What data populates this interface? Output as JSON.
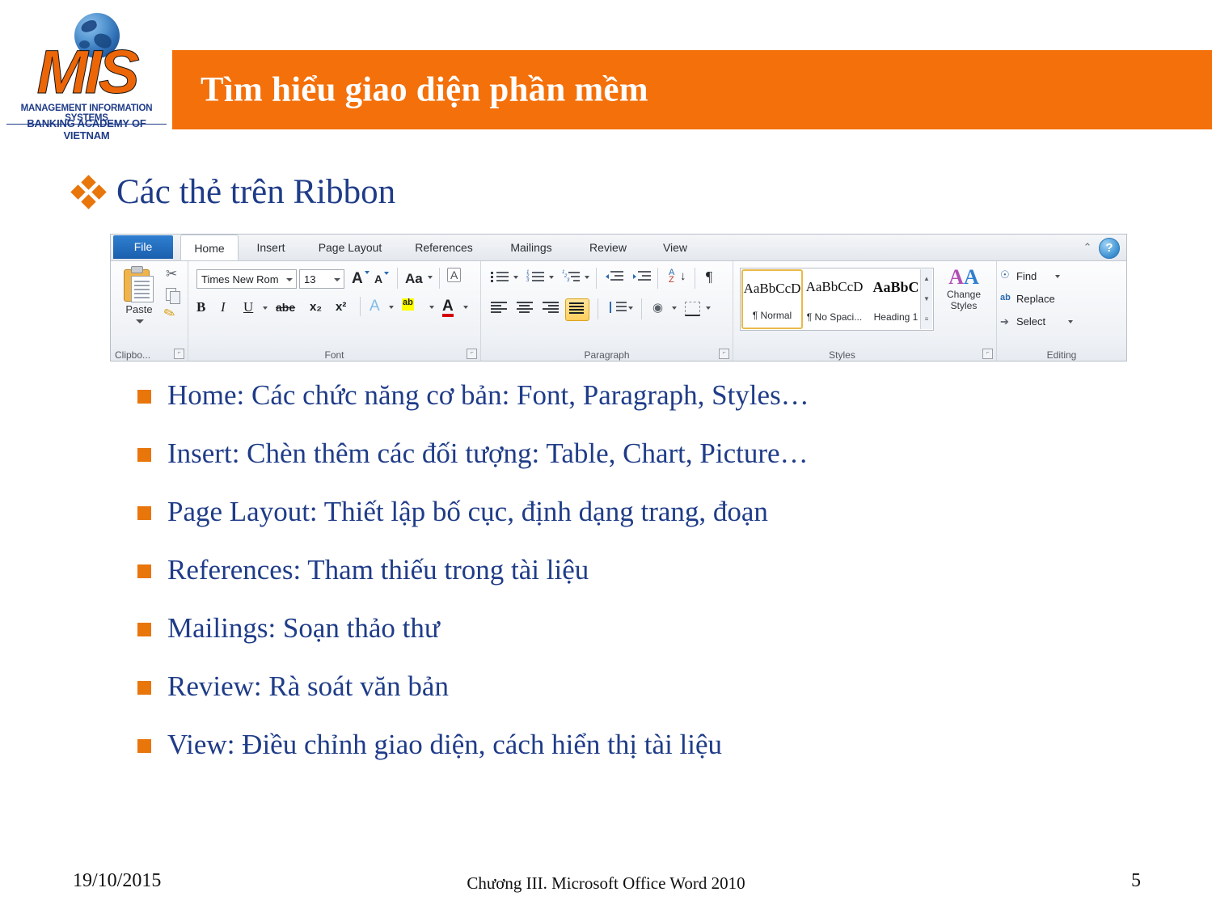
{
  "logo": {
    "acronym": "MIS",
    "line1": "MANAGEMENT INFORMATION SYSTEMS",
    "line2": "BANKING ACADEMY OF VIETNAM",
    "orange": "#EC6608",
    "blue": "#1F3C88"
  },
  "header": {
    "title": "Tìm hiểu giao diện phần mềm",
    "bar_color": "#F4700A",
    "title_color": "#FFFFFF"
  },
  "subheading": {
    "text": "Các thẻ trên Ribbon",
    "bullet_icon": "diamond-cluster-icon",
    "bullet_color": "#E8760B",
    "text_color": "#1F3C88"
  },
  "ribbon": {
    "file_tab": "File",
    "tabs": [
      {
        "label": "Home",
        "active": true
      },
      {
        "label": "Insert",
        "active": false
      },
      {
        "label": "Page Layout",
        "active": false
      },
      {
        "label": "References",
        "active": false
      },
      {
        "label": "Mailings",
        "active": false
      },
      {
        "label": "Review",
        "active": false
      },
      {
        "label": "View",
        "active": false
      }
    ],
    "help_glyph": "?",
    "minimize_glyph": "⌃",
    "groups": {
      "clipboard": {
        "label": "Clipbo...",
        "paste_label": "Paste",
        "cut_icon": "scissors-icon",
        "copy_icon": "copy-icon",
        "format_painter_icon": "format-painter-icon",
        "dialog_launcher": "⌐"
      },
      "font": {
        "label": "Font",
        "font_name_value": "Times New Rom",
        "font_size_value": "13",
        "grow_font": "A",
        "shrink_font": "A",
        "change_case": "Aa",
        "clear_formatting": "clear-formatting-icon",
        "bold": "B",
        "italic": "I",
        "underline": "U",
        "strikethrough": "abe",
        "subscript": "x₂",
        "superscript": "x²",
        "text_effects": "A",
        "highlight": "ab",
        "font_color": "A",
        "dialog_launcher": "⌐"
      },
      "paragraph": {
        "label": "Paragraph",
        "bullets_icon": "bullet-list-icon",
        "numbering_icon": "numbered-list-icon",
        "multilevel_icon": "multilevel-list-icon",
        "decrease_indent_icon": "decrease-indent-icon",
        "increase_indent_icon": "increase-indent-icon",
        "sort_icon": "sort-az-icon",
        "show_marks_icon": "¶",
        "align_left_icon": "align-left-icon",
        "align_center_icon": "align-center-icon",
        "align_right_icon": "align-right-icon",
        "justify_icon": "justify-icon",
        "line_spacing_icon": "line-spacing-icon",
        "shading_icon": "shading-icon",
        "borders_icon": "borders-icon",
        "dialog_launcher": "⌐"
      },
      "styles": {
        "label": "Styles",
        "items": [
          {
            "preview": "AaBbCcD",
            "name": "¶ Normal",
            "selected": true
          },
          {
            "preview": "AaBbCcD",
            "name": "¶ No Spaci...",
            "selected": false
          },
          {
            "preview": "AaBbC",
            "name": "Heading 1",
            "selected": false
          }
        ],
        "change_styles_label_1": "Change",
        "change_styles_label_2": "Styles",
        "dialog_launcher": "⌐"
      },
      "editing": {
        "label": "Editing",
        "items": [
          {
            "label": "Find",
            "icon": "binoculars-icon",
            "has_arrow": true
          },
          {
            "label": "Replace",
            "icon": "replace-icon",
            "has_arrow": false
          },
          {
            "label": "Select",
            "icon": "cursor-select-icon",
            "has_arrow": true
          }
        ]
      }
    }
  },
  "bullets": [
    "Home: Các chức năng cơ bản: Font, Paragraph, Styles…",
    "Insert: Chèn thêm các đối tượng: Table, Chart, Picture…",
    "Page Layout: Thiết lập bố cục, định dạng trang, đoạn",
    "References: Tham thiếu trong tài liệu",
    "Mailings: Soạn thảo thư",
    "Review: Rà soát văn bản",
    "View: Điều chỉnh giao diện, cách hiển thị tài liệu"
  ],
  "footer": {
    "date": "19/10/2015",
    "center": "Chương III. Microsoft Office Word 2010",
    "page_number": "5"
  }
}
